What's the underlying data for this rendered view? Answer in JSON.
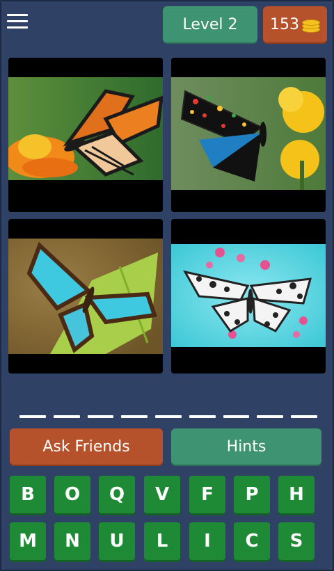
{
  "header": {
    "menu_icon": "hamburger-menu-icon",
    "level_label": "Level 2",
    "coins": "153",
    "coin_icon": "coin-stack-icon"
  },
  "images": [
    {
      "subject": "monarch butterfly on orange flower"
    },
    {
      "subject": "black butterfly with colorful spots on yellow flower"
    },
    {
      "subject": "blue morpho butterfly on leaf"
    },
    {
      "subject": "black and white spotted butterfly with pink flowers"
    }
  ],
  "answer_slots": 9,
  "actions": {
    "ask_friends": "Ask Friends",
    "hints": "Hints"
  },
  "keyboard": {
    "row1": [
      "B",
      "O",
      "Q",
      "V",
      "F",
      "P",
      "H"
    ],
    "row2": [
      "M",
      "N",
      "U",
      "L",
      "I",
      "C",
      "S"
    ]
  },
  "colors": {
    "background": "#2f4266",
    "green_button": "#3e9372",
    "orange_button": "#b5522b",
    "key_green": "#1f8a36"
  }
}
